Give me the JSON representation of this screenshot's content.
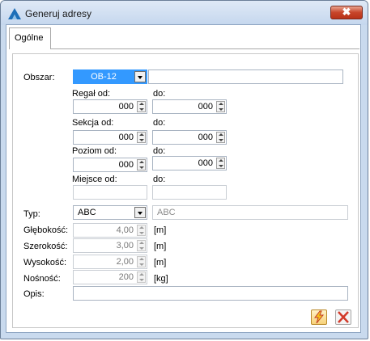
{
  "window": {
    "title": "Generuj adresy",
    "close_symbol": "✖"
  },
  "tabs": [
    {
      "label": "Ogólne"
    }
  ],
  "form": {
    "obszar": {
      "label": "Obszar:",
      "value": "OB-12",
      "text": ""
    },
    "regal": {
      "from_label": "Regał od:",
      "to_label": "do:",
      "from": "000",
      "to": "000"
    },
    "sekcja": {
      "from_label": "Sekcja od:",
      "to_label": "do:",
      "from": "000",
      "to": "000"
    },
    "poziom": {
      "from_label": "Poziom od:",
      "to_label": "do:",
      "from": "000",
      "to": "000"
    },
    "miejsce": {
      "from_label": "Miejsce od:",
      "to_label": "do:",
      "from": "",
      "to": ""
    },
    "typ": {
      "label": "Typ:",
      "value": "ABC",
      "description": "ABC"
    },
    "glebokosc": {
      "label": "Głębokość:",
      "value": "4,00",
      "unit": "[m]"
    },
    "szerokosc": {
      "label": "Szerokość:",
      "value": "3,00",
      "unit": "[m]"
    },
    "wysokosc": {
      "label": "Wysokość:",
      "value": "2,00",
      "unit": "[m]"
    },
    "nosnosc": {
      "label": "Nośność:",
      "value": "200",
      "unit": "[kg]"
    },
    "opis": {
      "label": "Opis:",
      "value": ""
    }
  },
  "buttons": {
    "generate_icon": "lightning-icon",
    "cancel_icon": "close-x-icon"
  },
  "colors": {
    "selection": "#3399ff",
    "close": "#c7452a",
    "cancel_x": "#d23a2a"
  }
}
